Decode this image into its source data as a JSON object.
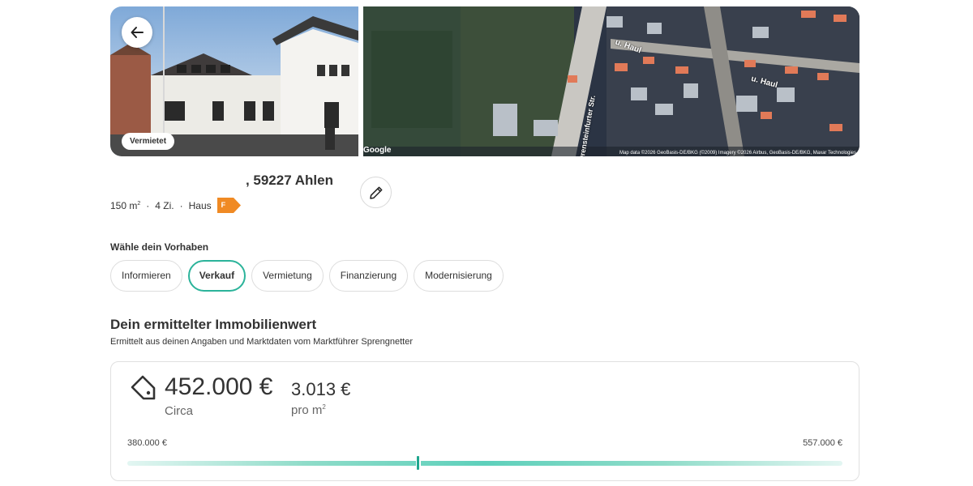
{
  "hero": {
    "status": "Vermietet",
    "map_brand": "Google",
    "map_copyright": "Map data ©2026 GeoBasis-DE/BKG (©2009) Imagery ©2026 Airbus, GeoBasis-DE/BKG, Maxar Technologies",
    "map_labels": [
      "u. Haul",
      "u. Haul",
      "Drensteinfurter Str."
    ]
  },
  "property": {
    "address": ", 59227 Ahlen",
    "area": "150 m",
    "area_exp": "2",
    "rooms": "4 Zi.",
    "type": "Haus",
    "energy_class": "F",
    "separator": "·",
    "energy_color": "#f08a24"
  },
  "intent": {
    "title": "Wähle dein Vorhaben",
    "options": [
      "Informieren",
      "Verkauf",
      "Vermietung",
      "Finanzierung",
      "Modernisierung"
    ],
    "selected": "Verkauf"
  },
  "valuation": {
    "title": "Dein ermittelter Immobilienwert",
    "subtitle": "Ermittelt aus deinen Angaben und Marktdaten vom Marktführer Sprengnetter",
    "price": "452.000 €",
    "price_note": "Circa",
    "price_per_sqm": "3.013 €",
    "per_sqm_label": "pro m",
    "per_sqm_exp": "2",
    "range_min_label": "380.000 €",
    "range_max_label": "557.000 €",
    "range_min": 380000,
    "range_max": 557000,
    "estimate": 452000,
    "accent_color": "#2bb39a"
  }
}
